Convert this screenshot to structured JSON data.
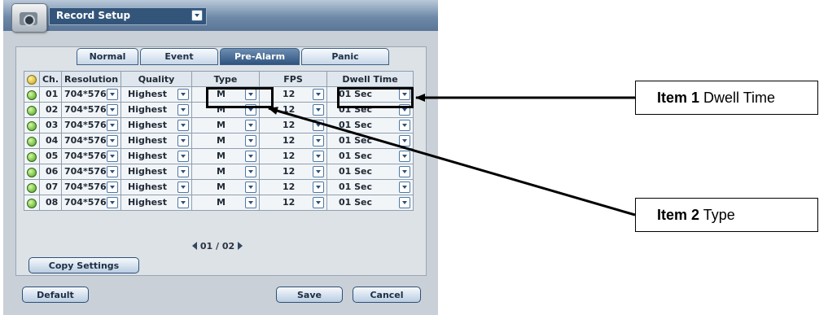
{
  "window": {
    "title": "Record Setup"
  },
  "tabs": [
    {
      "label": "Normal",
      "active": false
    },
    {
      "label": "Event",
      "active": false
    },
    {
      "label": "Pre-Alarm",
      "active": true
    },
    {
      "label": "Panic",
      "active": false
    }
  ],
  "table": {
    "headers": [
      "",
      "Ch.",
      "Resolution",
      "Quality",
      "Type",
      "FPS",
      "Dwell Time"
    ],
    "rows": [
      {
        "ch": "01",
        "resolution": "704*576",
        "quality": "Highest",
        "type": "M",
        "fps": "12",
        "dwell": "01 Sec"
      },
      {
        "ch": "02",
        "resolution": "704*576",
        "quality": "Highest",
        "type": "M",
        "fps": "12",
        "dwell": "01 Sec"
      },
      {
        "ch": "03",
        "resolution": "704*576",
        "quality": "Highest",
        "type": "M",
        "fps": "12",
        "dwell": "01 Sec"
      },
      {
        "ch": "04",
        "resolution": "704*576",
        "quality": "Highest",
        "type": "M",
        "fps": "12",
        "dwell": "01 Sec"
      },
      {
        "ch": "05",
        "resolution": "704*576",
        "quality": "Highest",
        "type": "M",
        "fps": "12",
        "dwell": "01 Sec"
      },
      {
        "ch": "06",
        "resolution": "704*576",
        "quality": "Highest",
        "type": "M",
        "fps": "12",
        "dwell": "01 Sec"
      },
      {
        "ch": "07",
        "resolution": "704*576",
        "quality": "Highest",
        "type": "M",
        "fps": "12",
        "dwell": "01 Sec"
      },
      {
        "ch": "08",
        "resolution": "704*576",
        "quality": "Highest",
        "type": "M",
        "fps": "12",
        "dwell": "01 Sec"
      }
    ]
  },
  "pager": "01 / 02",
  "buttons": {
    "copy_settings": "Copy Settings",
    "default": "Default",
    "save": "Save",
    "cancel": "Cancel"
  },
  "callouts": [
    {
      "bold": "Item 1",
      "text": " Dwell Time"
    },
    {
      "bold": "Item 2",
      "text": " Type"
    }
  ],
  "colors": {
    "active_tab": "#2f5480",
    "status_led": "#47a11a",
    "highlight": "#000000"
  }
}
